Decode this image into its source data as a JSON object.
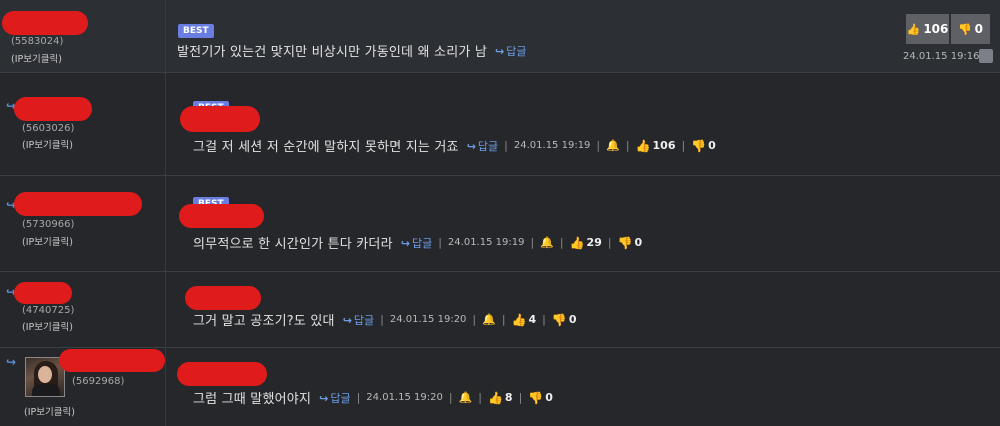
{
  "comments": [
    {
      "uid": "(5583024)",
      "ip": "(IP보기클릭)",
      "badge": "BEST",
      "text": "발전기가 있는건 맞지만 비상시만 가동인데 왜 소리가 남",
      "reply": "답글",
      "date": "24.01.15 19:16",
      "up": "106",
      "down": "0"
    },
    {
      "uid": "(5603026)",
      "ip": "(IP보기클릭)",
      "badge": "BEST",
      "text": "그걸 저 세션 저 순간에 말하지 못하면 지는 거죠",
      "reply": "답글",
      "date": "24.01.15 19:19",
      "up": "106",
      "down": "0"
    },
    {
      "uid": "(5730966)",
      "ip": "(IP보기클릭)",
      "badge": "BEST",
      "text": "의무적으로 한 시간인가 튼다 카더라",
      "reply": "답글",
      "date": "24.01.15 19:19",
      "up": "29",
      "down": "0"
    },
    {
      "uid": "(4740725)",
      "ip": "(IP보기클릭)",
      "text": "그거 말고 공조기?도 있대",
      "reply": "답글",
      "date": "24.01.15 19:20",
      "up": "4",
      "down": "0"
    },
    {
      "uid": "(5692968)",
      "ip": "(IP보기클릭)",
      "text": "그럼 그때 말했어야지",
      "reply": "답글",
      "date": "24.01.15 19:20",
      "up": "8",
      "down": "0"
    }
  ],
  "icons": {
    "reply_arrow": "↪",
    "thumb_up": "👍",
    "thumb_down": "👎",
    "bell": "bell-icon"
  },
  "colors": {
    "background": "#25272b",
    "best_badge": "#6a7de0",
    "link": "#6f9fe8",
    "redaction": "#e01b1b"
  }
}
